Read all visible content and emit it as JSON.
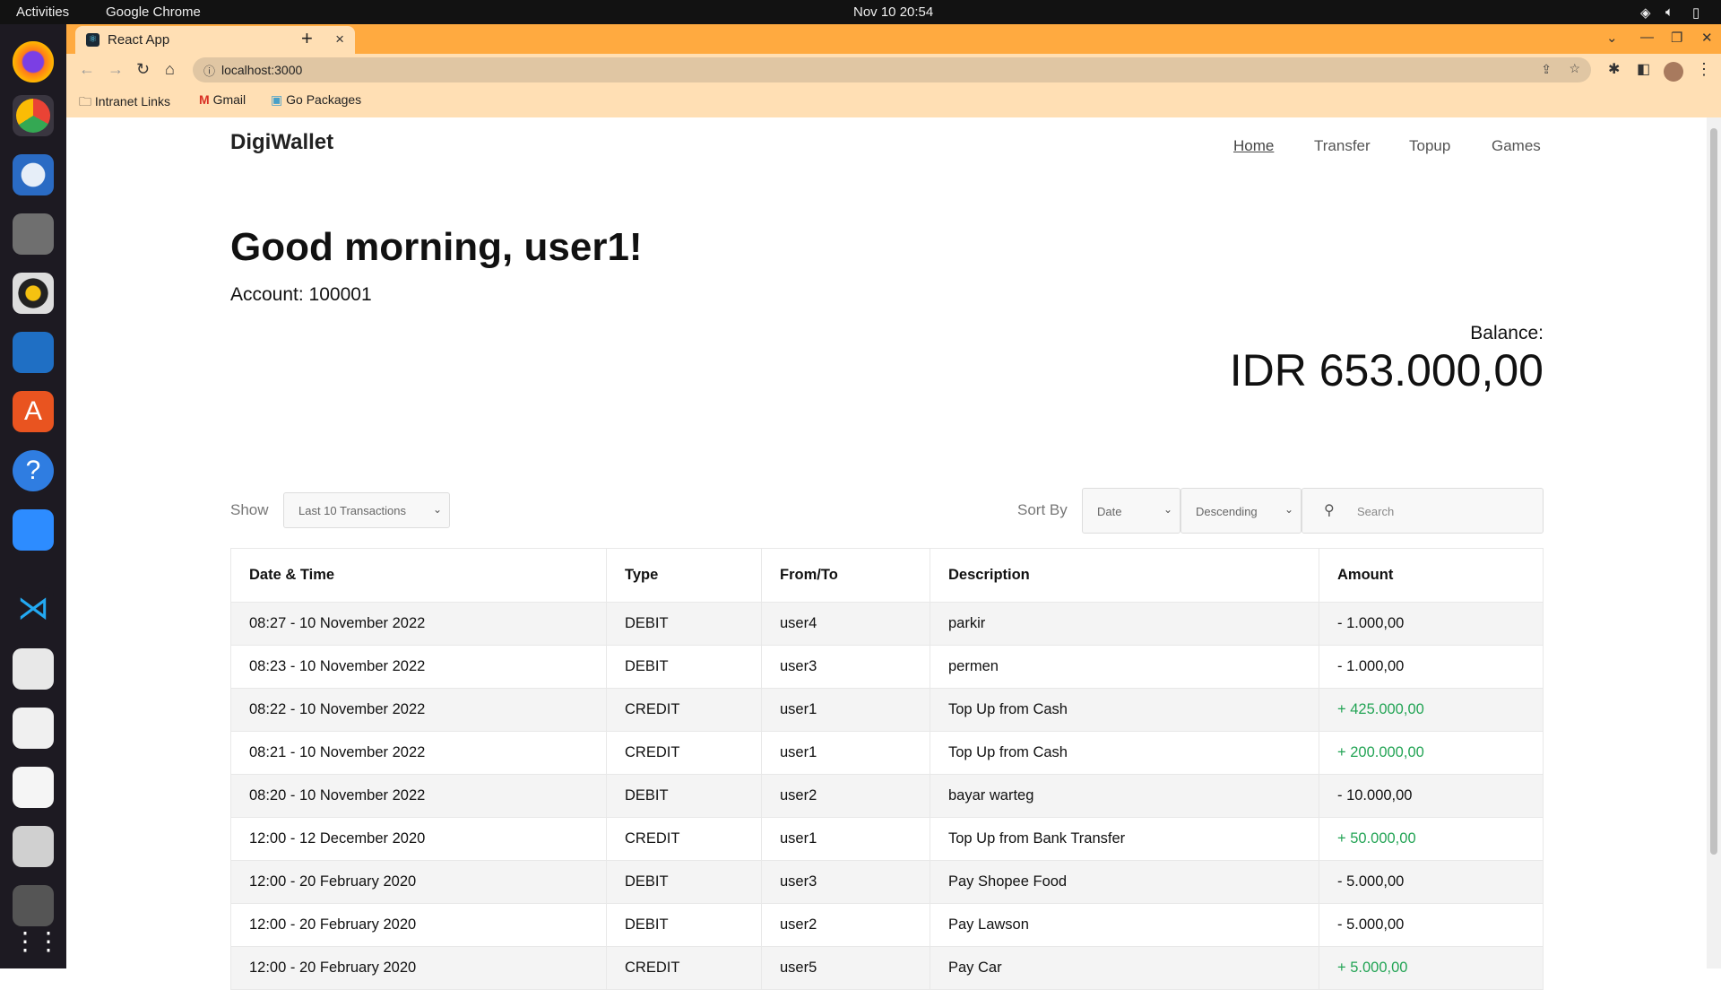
{
  "os": {
    "activities": "Activities",
    "app": "Google Chrome",
    "clock": "Nov 10  20:54"
  },
  "browser": {
    "tab_title": "React App",
    "url": "localhost:3000",
    "bookmarks": [
      "Intranet Links",
      "Gmail",
      "Go Packages"
    ]
  },
  "app": {
    "brand": "DigiWallet",
    "nav": [
      {
        "label": "Home",
        "active": true
      },
      {
        "label": "Transfer"
      },
      {
        "label": "Topup"
      },
      {
        "label": "Games"
      }
    ]
  },
  "greeting": "Good morning, user1!",
  "account": "Account: 100001",
  "balance_label": "Balance:",
  "balance": "IDR 653.000,00",
  "controls": {
    "show_label": "Show",
    "show_value": "Last 10 Transactions",
    "sort_label": "Sort By",
    "sort_field": "Date",
    "sort_order": "Descending",
    "search_placeholder": "Search"
  },
  "table": {
    "headers": [
      "Date & Time",
      "Type",
      "From/To",
      "Description",
      "Amount"
    ],
    "rows": [
      [
        "08:27 - 10 November 2022",
        "DEBIT",
        "user4",
        "parkir",
        "- 1.000,00"
      ],
      [
        "08:23 - 10 November 2022",
        "DEBIT",
        "user3",
        "permen",
        "- 1.000,00"
      ],
      [
        "08:22 - 10 November 2022",
        "CREDIT",
        "user1",
        "Top Up from Cash",
        "+  425.000,00"
      ],
      [
        "08:21 - 10 November 2022",
        "CREDIT",
        "user1",
        "Top Up from Cash",
        "+  200.000,00"
      ],
      [
        "08:20 - 10 November 2022",
        "DEBIT",
        "user2",
        "bayar warteg",
        "- 10.000,00"
      ],
      [
        "12:00 - 12 December 2020",
        "CREDIT",
        "user1",
        "Top Up from Bank Transfer",
        "+  50.000,00"
      ],
      [
        "12:00 - 20 February 2020",
        "DEBIT",
        "user3",
        "Pay Shopee Food",
        "- 5.000,00"
      ],
      [
        "12:00 - 20 February 2020",
        "DEBIT",
        "user2",
        "Pay Lawson",
        "- 5.000,00"
      ],
      [
        "12:00 - 20 February 2020",
        "CREDIT",
        "user5",
        "Pay Car",
        "+  5.000,00"
      ]
    ]
  },
  "colors": {
    "credit": "#23a455",
    "tabstrip": "#ffaa40"
  }
}
